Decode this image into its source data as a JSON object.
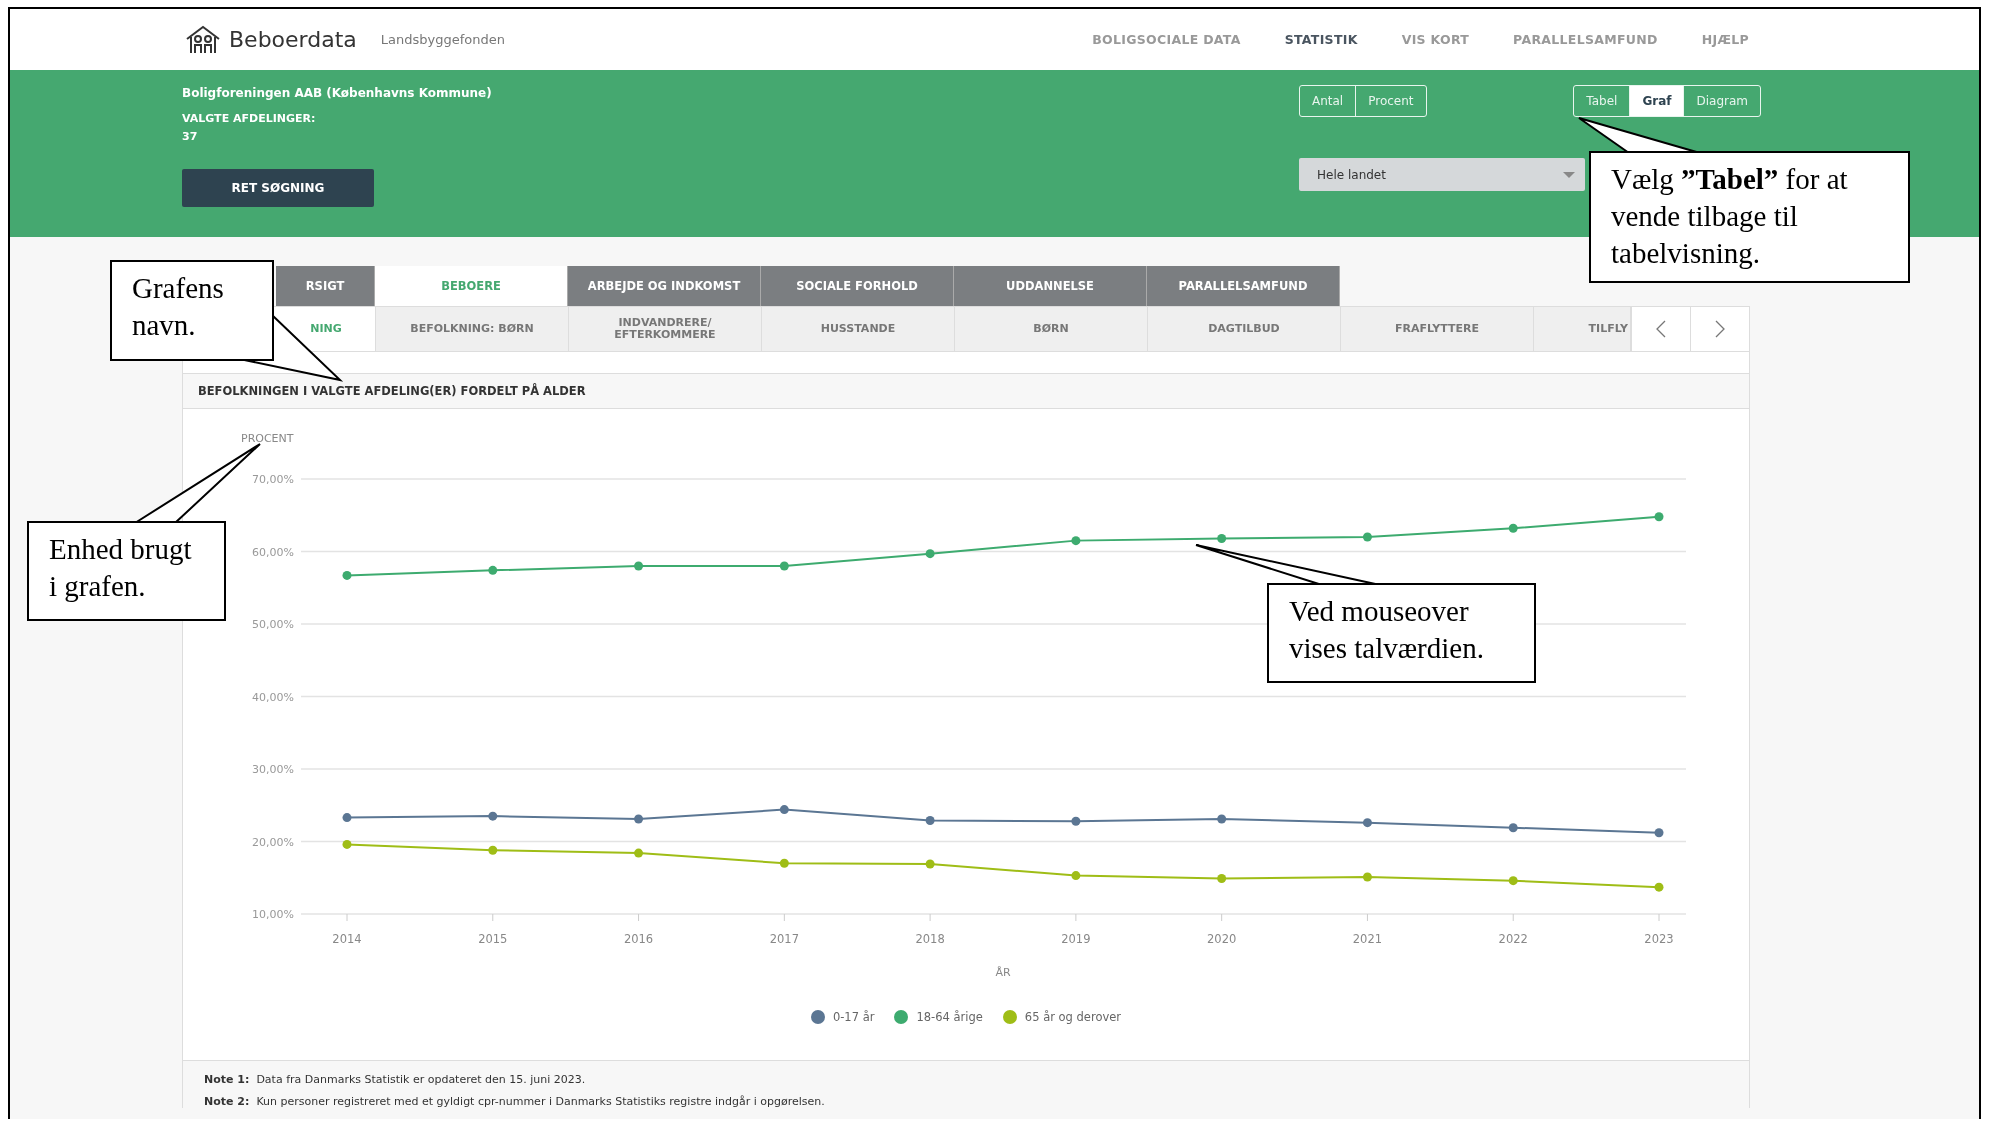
{
  "header": {
    "logo_text": "Beboerdata",
    "subtitle": "Landsbyggefonden",
    "nav": [
      {
        "label": "BOLIGSOCIALE DATA",
        "selected": false
      },
      {
        "label": "STATISTIK",
        "selected": true
      },
      {
        "label": "VIS KORT",
        "selected": false
      },
      {
        "label": "PARALLELSAMFUND",
        "selected": false
      },
      {
        "label": "HJÆLP",
        "selected": false
      }
    ]
  },
  "selection": {
    "organization": "Boligforeningen AAB (Københavns Kommune)",
    "departments_label": "VALGTE AFDELINGER:",
    "departments_count": "37",
    "edit_button": "RET SØGNING"
  },
  "unit_toggle": [
    {
      "label": "Antal",
      "selected": false
    },
    {
      "label": "Procent",
      "selected": false
    }
  ],
  "view_toggle": [
    {
      "label": "Tabel",
      "selected": false
    },
    {
      "label": "Graf",
      "selected": true
    },
    {
      "label": "Diagram",
      "selected": false
    }
  ],
  "area_dropdown": {
    "value": "Hele landet"
  },
  "main_tabs": [
    {
      "label": "RSIGT",
      "selected": false
    },
    {
      "label": "BEBOERE",
      "selected": true
    },
    {
      "label": "ARBEJDE OG INDKOMST",
      "selected": false
    },
    {
      "label": "SOCIALE FORHOLD",
      "selected": false
    },
    {
      "label": "UDDANNELSE",
      "selected": false
    },
    {
      "label": "PARALLELSAMFUND",
      "selected": false
    }
  ],
  "sub_tabs": [
    {
      "label": "NING",
      "selected": true
    },
    {
      "label": "BEFOLKNING: BØRN",
      "selected": false
    },
    {
      "label": "INDVANDRERE/ EFTERKOMMERE",
      "selected": false
    },
    {
      "label": "HUSSTANDE",
      "selected": false
    },
    {
      "label": "BØRN",
      "selected": false
    },
    {
      "label": "DAGTILBUD",
      "selected": false
    },
    {
      "label": "FRAFLYTTERE",
      "selected": false
    },
    {
      "label": "TILFLY",
      "selected": false
    }
  ],
  "chart_title": "BEFOLKNINGEN I VALGTE AFDELING(ER) FORDELT PÅ ALDER",
  "chart_data": {
    "type": "line",
    "xlabel": "ÅR",
    "ylabel": "PROCENT",
    "grid": true,
    "legend": true,
    "categories": [
      "2014",
      "2015",
      "2016",
      "2017",
      "2018",
      "2019",
      "2020",
      "2021",
      "2022",
      "2023"
    ],
    "series": [
      {
        "name": "0-17 år",
        "color": "#5b7693",
        "marker": "circle",
        "values": [
          23.3,
          23.5,
          23.1,
          24.4,
          22.9,
          22.8,
          23.1,
          22.6,
          21.9,
          21.2
        ]
      },
      {
        "name": "18-64 årige",
        "color": "#3dab6f",
        "marker": "circle",
        "values": [
          56.7,
          57.4,
          58.0,
          58.0,
          59.7,
          61.5,
          61.8,
          62.0,
          63.2,
          64.8
        ]
      },
      {
        "name": "65 år og derover",
        "color": "#9fbd16",
        "marker": "circle",
        "values": [
          19.6,
          18.8,
          18.4,
          17.0,
          16.9,
          15.3,
          14.9,
          15.1,
          14.6,
          13.7
        ]
      }
    ],
    "ylim": [
      10,
      70
    ],
    "yticks": [
      {
        "value": 10,
        "label": "10,00%"
      },
      {
        "value": 20,
        "label": "20,00%"
      },
      {
        "value": 30,
        "label": "30,00%"
      },
      {
        "value": 40,
        "label": "40,00%"
      },
      {
        "value": 50,
        "label": "50,00%"
      },
      {
        "value": 60,
        "label": "60,00%"
      },
      {
        "value": 70,
        "label": "70,00%"
      }
    ]
  },
  "notes": [
    {
      "label": "Note 1:",
      "text": "Data fra Danmarks Statistik er opdateret den 15. juni 2023."
    },
    {
      "label": "Note 2:",
      "text": "Kun personer registreret med et gyldigt cpr-nummer i Danmarks Statistiks registre indgår i opgørelsen."
    }
  ],
  "callouts": [
    {
      "text": "Grafens navn."
    },
    {
      "text": "Enhed brugt i grafen."
    },
    {
      "text": "Ved mouseover vises talværdien."
    },
    {
      "text": "Vælg **”Tabel”** for at vende tilbage til tabelvisning."
    }
  ]
}
